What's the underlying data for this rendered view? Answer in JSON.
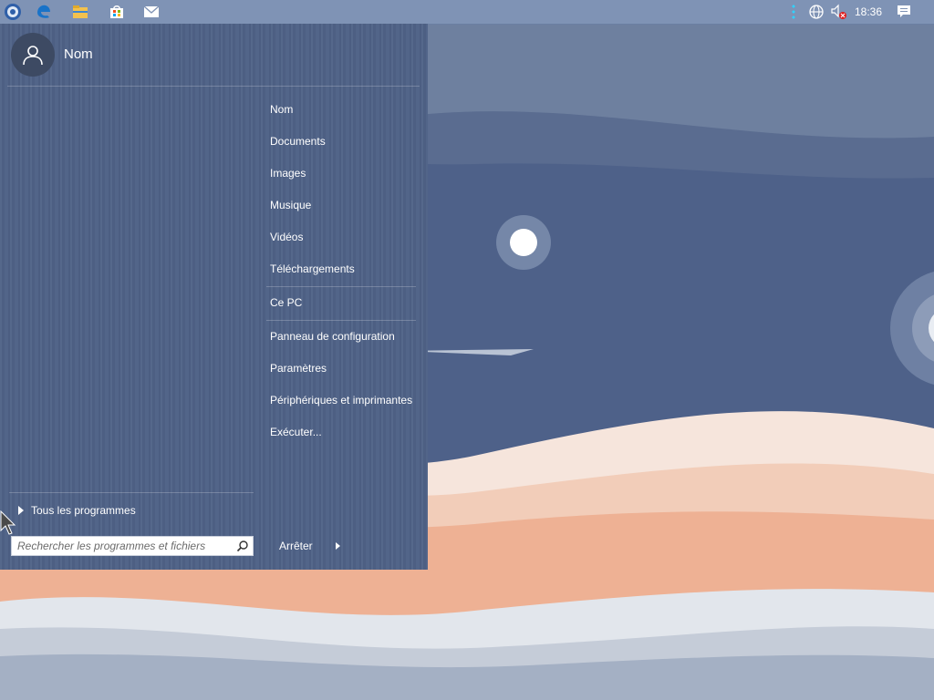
{
  "taskbar": {
    "items": [
      {
        "name": "start-button"
      },
      {
        "name": "edge-browser"
      },
      {
        "name": "file-explorer"
      },
      {
        "name": "store"
      },
      {
        "name": "mail"
      }
    ],
    "tray": {
      "time": "18:36"
    }
  },
  "start_menu": {
    "user_name": "Nom",
    "items": [
      {
        "label": "Nom"
      },
      {
        "label": "Documents"
      },
      {
        "label": "Images"
      },
      {
        "label": "Musique"
      },
      {
        "label": "Vidéos"
      },
      {
        "label": "Téléchargements"
      },
      {
        "label": "Ce PC"
      },
      {
        "label": "Panneau de configuration"
      },
      {
        "label": "Paramètres"
      },
      {
        "label": "Périphériques et imprimantes"
      },
      {
        "label": "Exécuter..."
      }
    ],
    "all_programs_label": "Tous les programmes",
    "search_placeholder": "Rechercher les programmes et fichiers",
    "shutdown_label": "Arrêter"
  },
  "colors": {
    "menu_bg": "#4f6287",
    "taskbar_bg": "#7f93b5",
    "accent_blue": "#1a73c8"
  }
}
